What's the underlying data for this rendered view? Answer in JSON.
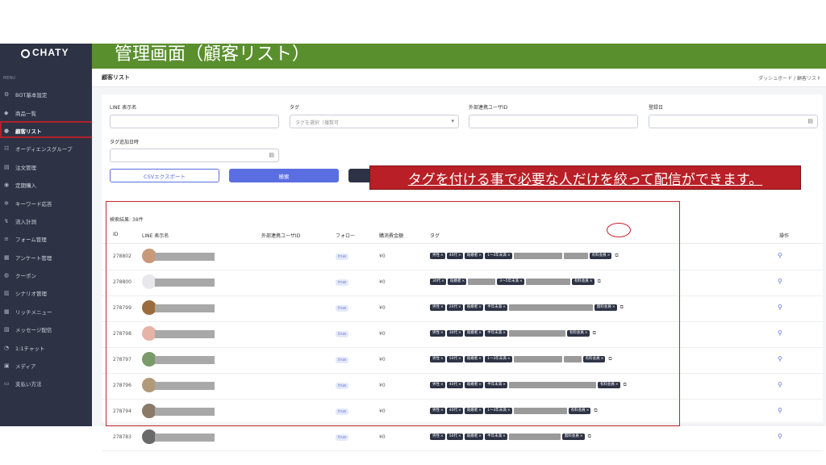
{
  "banner": {
    "title": "管理画面（顧客リスト）"
  },
  "sidebar": {
    "logo": "CHATY",
    "menu_caption": "MENU",
    "items": [
      {
        "label": "BOT基本設定",
        "icon": "robot-icon",
        "glyph": "⚙"
      },
      {
        "label": "商品一覧",
        "icon": "diamond-icon",
        "glyph": "◆"
      },
      {
        "label": "顧客リスト",
        "icon": "user-icon",
        "glyph": "●",
        "active": true
      },
      {
        "label": "オーディエンスグループ",
        "icon": "group-icon",
        "glyph": "☷"
      },
      {
        "label": "注文管理",
        "icon": "cart-icon",
        "glyph": "▤"
      },
      {
        "label": "定期購入",
        "icon": "repeat-icon",
        "glyph": "◉"
      },
      {
        "label": "キーワード応答",
        "icon": "key-icon",
        "glyph": "✲"
      },
      {
        "label": "流入計測",
        "icon": "inflow-icon",
        "glyph": "↯"
      },
      {
        "label": "フォーム管理",
        "icon": "form-icon",
        "glyph": "≡"
      },
      {
        "label": "アンケート管理",
        "icon": "survey-icon",
        "glyph": "▦"
      },
      {
        "label": "クーポン",
        "icon": "coupon-icon",
        "glyph": "◍"
      },
      {
        "label": "シナリオ管理",
        "icon": "scenario-icon",
        "glyph": "▥"
      },
      {
        "label": "リッチメニュー",
        "icon": "grid-icon",
        "glyph": "▦"
      },
      {
        "label": "メッセージ配信",
        "icon": "message-icon",
        "glyph": "▧"
      },
      {
        "label": "1:1チャット",
        "icon": "chat-icon",
        "glyph": "◔"
      },
      {
        "label": "メディア",
        "icon": "media-icon",
        "glyph": "▣"
      },
      {
        "label": "支払い方法",
        "icon": "payment-icon",
        "glyph": "▭"
      }
    ]
  },
  "header": {
    "page_title": "顧客リスト",
    "breadcrumb": "ダッシュボード / 顧客リスト"
  },
  "filters": {
    "line_name_label": "LINE 表示名",
    "tag_label": "タグ",
    "tag_placeholder": "タグを選択（複数可",
    "external_id_label": "外部連携ユーザID",
    "registered_label": "登録日",
    "tag_added_label": "タグ追加日時"
  },
  "buttons": {
    "csv": "CSVエクスポート",
    "search": "検索"
  },
  "result_count": "検索結果: 38件",
  "table": {
    "headers": {
      "id": "ID",
      "name": "LINE 表示名",
      "external": "外部連携ユーザID",
      "follow": "フォロー",
      "amount": "購消費金額",
      "tags": "タグ",
      "action": "操作"
    },
    "rows": [
      {
        "id": "278802",
        "follow": "true",
        "amount": "¥0",
        "avatar_color": "#c89a7a",
        "tags": [
          {
            "t": "男性"
          },
          {
            "t": "40代"
          },
          {
            "t": "既婚者"
          },
          {
            "t": "1〜3年未満"
          },
          {
            "bar": 60
          },
          {
            "bar": 30
          },
          {
            "t": "有料会員"
          }
        ]
      },
      {
        "id": "278800",
        "follow": "true",
        "amount": "¥0",
        "avatar_color": "#e8e8ec",
        "tags": [
          {
            "t": "30代"
          },
          {
            "t": "既婚者"
          },
          {
            "bar": 34
          },
          {
            "t": "3〜5年未満"
          },
          {
            "bar": 55
          },
          {
            "t": "有料会員"
          }
        ]
      },
      {
        "id": "278799",
        "follow": "true",
        "amount": "¥0",
        "avatar_color": "#9a6b3d",
        "tags": [
          {
            "t": "男性"
          },
          {
            "t": "20代"
          },
          {
            "t": "既婚者"
          },
          {
            "t": "半年未満"
          },
          {
            "bar": 104
          },
          {
            "t": "無料会員"
          }
        ]
      },
      {
        "id": "278798",
        "follow": "true",
        "amount": "¥0",
        "avatar_color": "#e6b3a6",
        "tags": [
          {
            "t": "男性"
          },
          {
            "t": "30代"
          },
          {
            "t": "既婚者"
          },
          {
            "t": "半年未満"
          },
          {
            "bar": 70
          },
          {
            "t": "有料会員"
          }
        ]
      },
      {
        "id": "278797",
        "follow": "true",
        "amount": "¥0",
        "avatar_color": "#7a9a6a",
        "tags": [
          {
            "t": "男性"
          },
          {
            "t": "50代"
          },
          {
            "t": "既婚者"
          },
          {
            "t": "1〜3年未満"
          },
          {
            "bar": 60
          },
          {
            "bar": 22
          },
          {
            "t": "有料会員"
          }
        ]
      },
      {
        "id": "278796",
        "follow": "true",
        "amount": "¥0",
        "avatar_color": "#b09a7a",
        "tags": [
          {
            "t": "男性"
          },
          {
            "t": "40代"
          },
          {
            "t": "既婚者"
          },
          {
            "t": "半年未満"
          },
          {
            "bar": 108
          },
          {
            "t": "有料会員"
          }
        ]
      },
      {
        "id": "278794",
        "follow": "true",
        "amount": "¥0",
        "avatar_color": "#8a7a6a",
        "tags": [
          {
            "t": "男性"
          },
          {
            "t": "40代"
          },
          {
            "t": "既婚者"
          },
          {
            "t": "1〜3年未満"
          },
          {
            "bar": 66
          },
          {
            "t": "有料会員"
          }
        ]
      },
      {
        "id": "278783",
        "follow": "true",
        "amount": "¥0",
        "avatar_color": "#6a6a6a",
        "tags": [
          {
            "t": "男性"
          },
          {
            "t": "50代"
          },
          {
            "t": "既婚者"
          },
          {
            "t": "半年未満"
          },
          {
            "bar": 64
          },
          {
            "t": "無料会員"
          }
        ]
      }
    ]
  },
  "callout": "タグを付ける事で必要な人だけを絞って配信ができます。"
}
